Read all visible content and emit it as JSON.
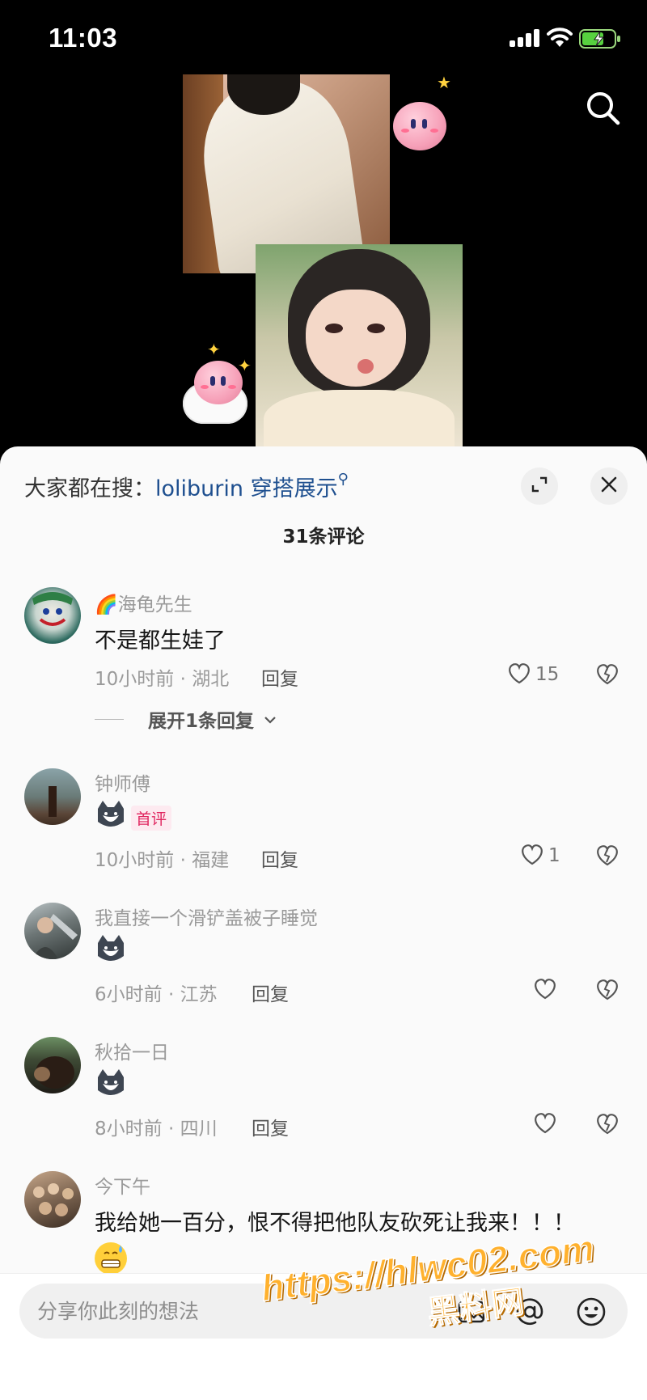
{
  "status_bar": {
    "time": "11:03"
  },
  "hot_search": {
    "prefix": "大家都在搜：",
    "keyword": "loliburin 穿搭展示"
  },
  "comments_header": {
    "count_label": "31条评论"
  },
  "comments": [
    {
      "name": "🌈海龟先生",
      "text": "不是都生娃了",
      "time_location": "10小时前 · 湖北",
      "reply_label": "回复",
      "likes": "15",
      "expand_label": "展开1条回复"
    },
    {
      "name": "钟师傅",
      "badge": "首评",
      "time_location": "10小时前 · 福建",
      "reply_label": "回复",
      "likes": "1"
    },
    {
      "name": "我直接一个滑铲盖被子睡觉",
      "time_location": "6小时前 · 江苏",
      "reply_label": "回复"
    },
    {
      "name": "秋拾一日",
      "time_location": "8小时前 · 四川",
      "reply_label": "回复"
    },
    {
      "name": "今下午",
      "text": "我给她一百分，恨不得把他队友砍死让我来！！！"
    }
  ],
  "input": {
    "placeholder": "分享你此刻的想法"
  },
  "watermark": {
    "url": "https://hlwc02.com",
    "name": "黑料网"
  },
  "icons": {
    "search": "search-icon",
    "expand": "expand-icon",
    "close": "close-icon",
    "like": "heart-icon",
    "dislike": "broken-heart-icon",
    "image": "image-icon",
    "at": "at-icon",
    "emoji": "emoji-icon",
    "chevron": "chevron-down-icon"
  },
  "colors": {
    "accent_link": "#1e4f8f",
    "badge": "#e0245e",
    "watermark": "#ffb12e"
  }
}
